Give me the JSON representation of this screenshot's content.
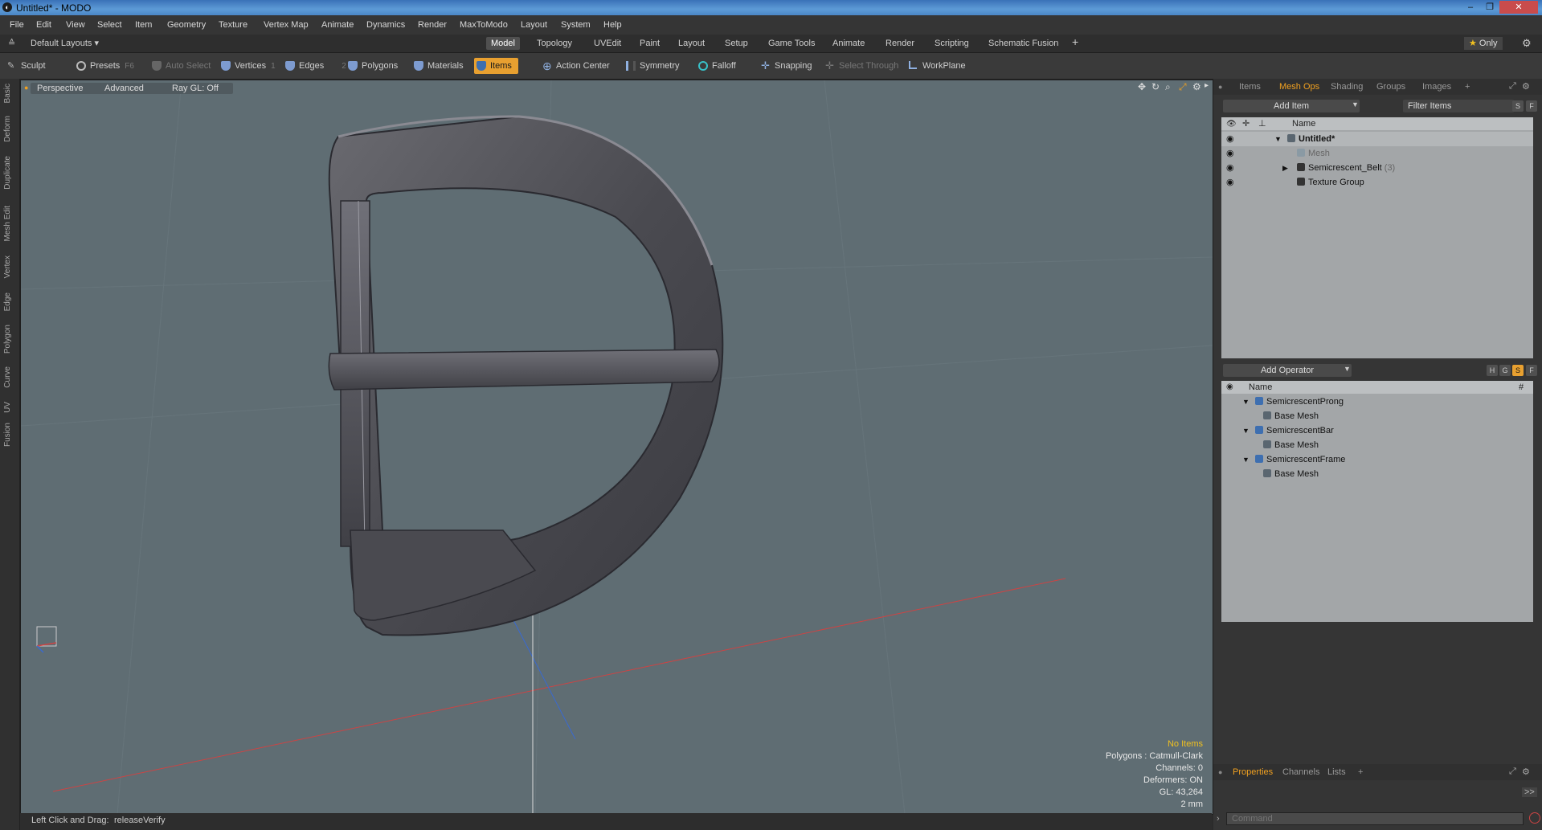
{
  "window": {
    "title": "Untitled* - MODO",
    "logo": "modo-logo-icon"
  },
  "menu": [
    "File",
    "Edit",
    "View",
    "Select",
    "Item",
    "Geometry",
    "Texture",
    "Vertex Map",
    "Animate",
    "Dynamics",
    "Render",
    "MaxToModo",
    "Layout",
    "System",
    "Help"
  ],
  "layout_bar": {
    "layout_dropdown": "Default Layouts",
    "tabs": [
      "Model",
      "Topology",
      "UVEdit",
      "Paint",
      "Layout",
      "Setup",
      "Game Tools",
      "Animate",
      "Render",
      "Scripting",
      "Schematic Fusion"
    ],
    "active_tab": "Model",
    "add": "+",
    "only": "Only"
  },
  "toolbar": {
    "sculpt": "Sculpt",
    "presets": "Presets",
    "presets_key": "F6",
    "auto_select": "Auto Select",
    "vertices": "Vertices",
    "vertices_key": "1",
    "edges": "Edges",
    "edges_key": "2",
    "polygons": "Polygons",
    "materials": "Materials",
    "items": "Items",
    "action_center": "Action Center",
    "symmetry": "Symmetry",
    "falloff": "Falloff",
    "snapping": "Snapping",
    "select_through": "Select Through",
    "workplane": "WorkPlane"
  },
  "left_tabs": [
    "Basic",
    "Deform",
    "Duplicate",
    "Mesh Edit",
    "Vertex",
    "Edge",
    "Polygon",
    "Curve",
    "UV",
    "Fusion"
  ],
  "viewport": {
    "view": "Perspective",
    "mode": "Advanced",
    "raygl": "Ray GL: Off",
    "info": {
      "selection": "No Items",
      "polygons": "Polygons : Catmull-Clark",
      "channels": "Channels: 0",
      "deformers": "Deformers: ON",
      "gl": "GL: 43,264",
      "scale": "2 mm"
    }
  },
  "status": {
    "hint": "Left Click and Drag:",
    "action": "releaseVerify"
  },
  "right_panel": {
    "tabs": [
      "Items",
      "Mesh Ops",
      "Shading",
      "Groups",
      "Images",
      "+"
    ],
    "active_tab": "Mesh Ops",
    "add_item": "Add Item",
    "filter": "Filter Items",
    "s_btn": "S",
    "f_btn": "F",
    "name_header": "Name",
    "tree": [
      {
        "label": "Untitled*",
        "bold": true
      },
      {
        "label": "Mesh",
        "dim": true
      },
      {
        "label": "Semicrescent_Belt",
        "count": "(3)"
      },
      {
        "label": "Texture Group"
      }
    ],
    "add_operator": "Add Operator",
    "op_buttons": [
      "H",
      "G",
      "S",
      "F"
    ],
    "ops_header_name": "Name",
    "ops_header_hash": "#",
    "ops": [
      {
        "label": "SemicrescentProng",
        "child": "Base Mesh"
      },
      {
        "label": "SemicrescentBar",
        "child": "Base Mesh"
      },
      {
        "label": "SemicrescentFrame",
        "child": "Base Mesh"
      }
    ],
    "bottom_tabs": [
      "Properties",
      "Channels",
      "Lists",
      "+"
    ],
    "active_bottom_tab": "Properties",
    "command_placeholder": "Command",
    "expand": ">>"
  },
  "colors": {
    "accent": "#e8a030",
    "viewport_bg": "#5f6d73",
    "list_bg": "#a3a6a8"
  }
}
